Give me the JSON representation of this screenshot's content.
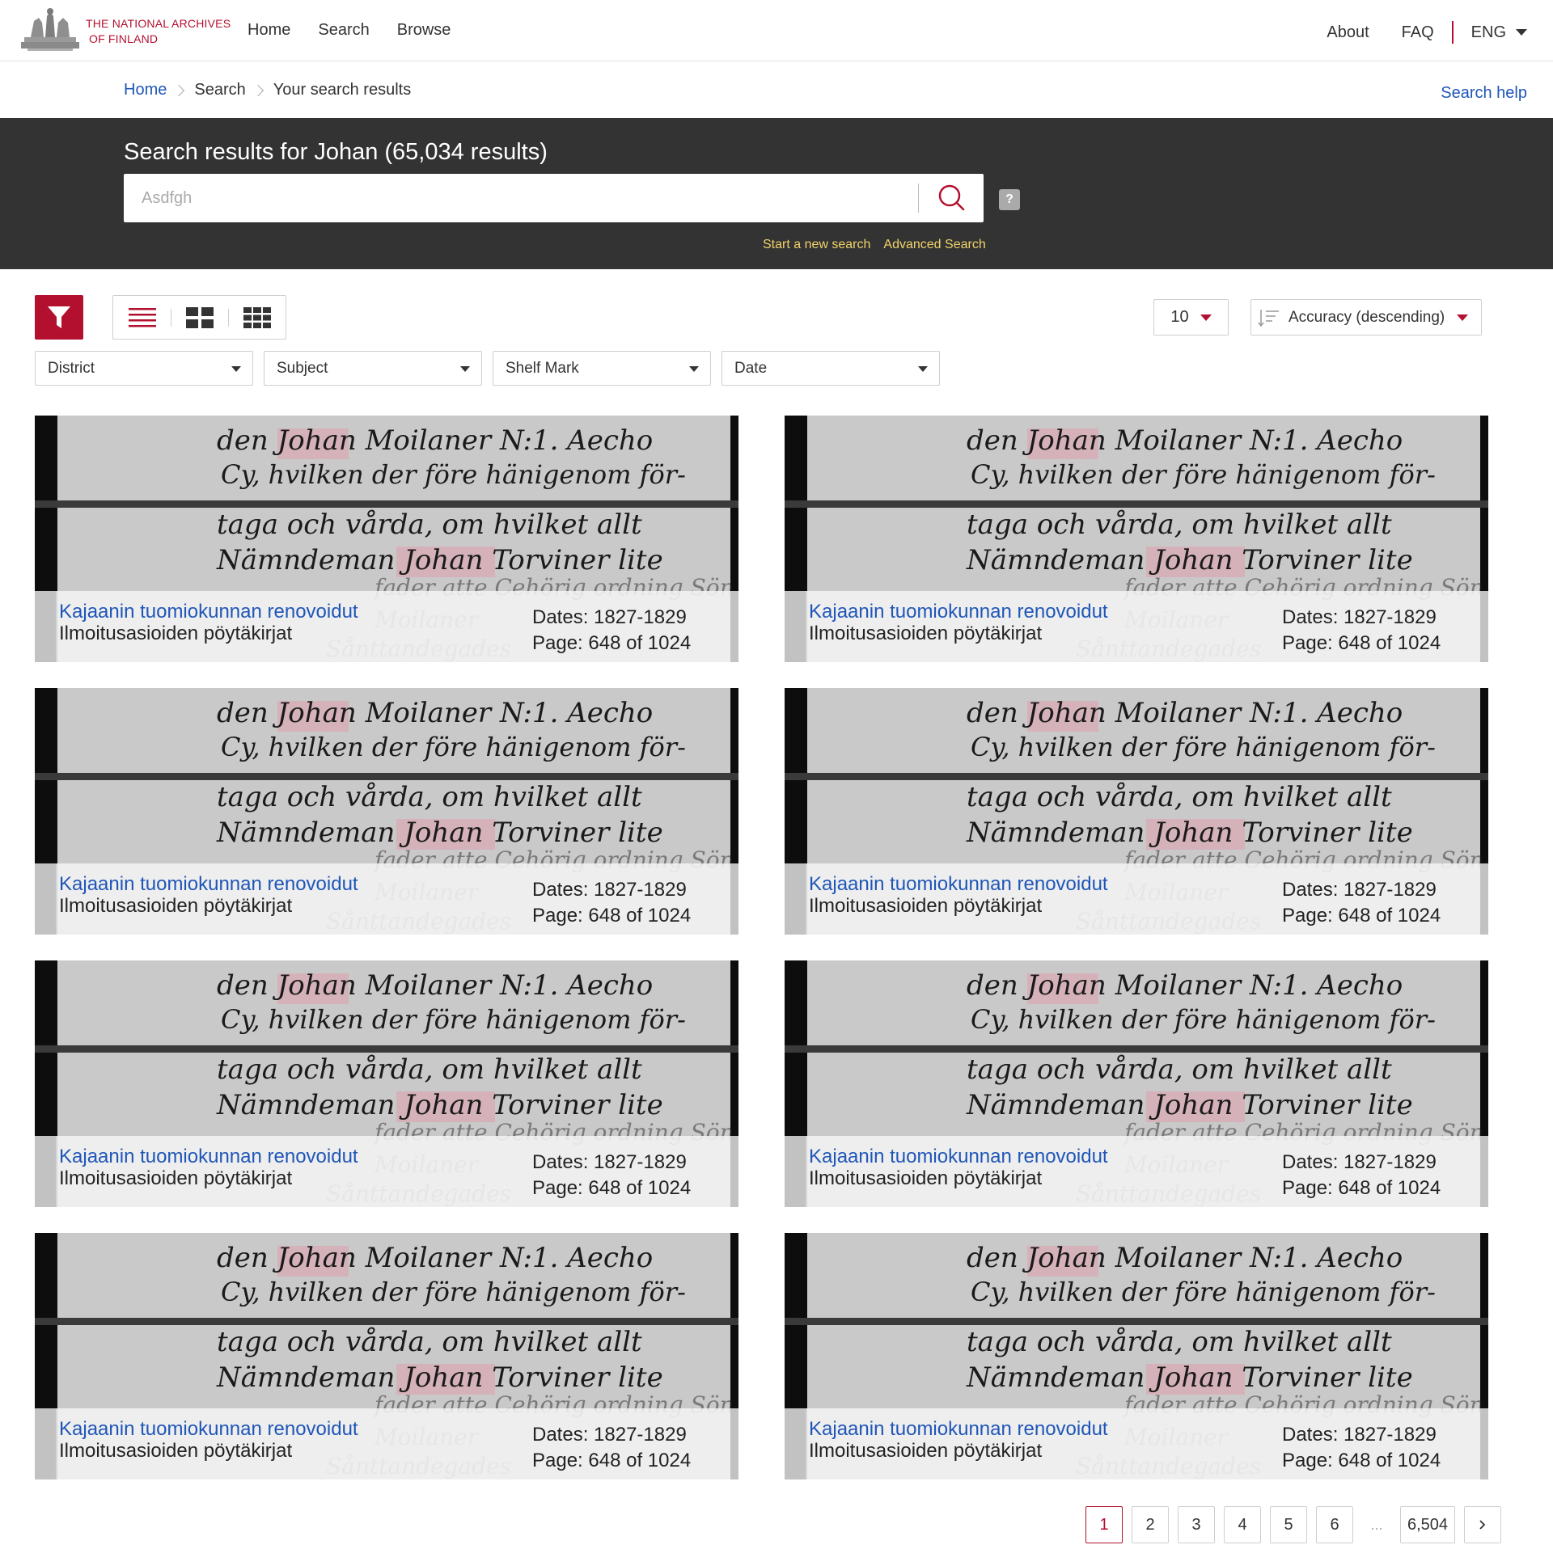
{
  "header": {
    "logo_line1": "THE NATIONAL ARCHIVES",
    "logo_line2": "OF FINLAND",
    "nav_left": [
      "Home",
      "Search",
      "Browse"
    ],
    "nav_right": [
      "About",
      "FAQ"
    ],
    "language": "ENG"
  },
  "breadcrumb": {
    "items": [
      "Home",
      "Search",
      "Your search results"
    ],
    "search_help": "Search help"
  },
  "search": {
    "title": "Search results for Johan (65,034 results)",
    "placeholder": "Asdfgh",
    "help_badge": "?",
    "start_new": "Start a new search",
    "advanced": "Advanced Search"
  },
  "toolbar": {
    "per_page": "10",
    "sort": "Accuracy (descending)"
  },
  "filters": [
    "District",
    "Subject",
    "Shelf Mark",
    "Date"
  ],
  "results": [
    {
      "title": "Kajaanin tuomiokunnan renovoidut",
      "subtitle": "Ilmoitusasioiden pöytäkirjat",
      "dates": "Dates: 1827-1829",
      "page": "Page: 648 of 1024"
    },
    {
      "title": "Kajaanin tuomiokunnan renovoidut",
      "subtitle": "Ilmoitusasioiden pöytäkirjat",
      "dates": "Dates: 1827-1829",
      "page": "Page: 648 of 1024"
    },
    {
      "title": "Kajaanin tuomiokunnan renovoidut",
      "subtitle": "Ilmoitusasioiden pöytäkirjat",
      "dates": "Dates: 1827-1829",
      "page": "Page: 648 of 1024"
    },
    {
      "title": "Kajaanin tuomiokunnan renovoidut",
      "subtitle": "Ilmoitusasioiden pöytäkirjat",
      "dates": "Dates: 1827-1829",
      "page": "Page: 648 of 1024"
    },
    {
      "title": "Kajaanin tuomiokunnan renovoidut",
      "subtitle": "Ilmoitusasioiden pöytäkirjat",
      "dates": "Dates: 1827-1829",
      "page": "Page: 648 of 1024"
    },
    {
      "title": "Kajaanin tuomiokunnan renovoidut",
      "subtitle": "Ilmoitusasioiden pöytäkirjat",
      "dates": "Dates: 1827-1829",
      "page": "Page: 648 of 1024"
    },
    {
      "title": "Kajaanin tuomiokunnan renovoidut",
      "subtitle": "Ilmoitusasioiden pöytäkirjat",
      "dates": "Dates: 1827-1829",
      "page": "Page: 648 of 1024"
    },
    {
      "title": "Kajaanin tuomiokunnan renovoidut",
      "subtitle": "Ilmoitusasioiden pöytäkirjat",
      "dates": "Dates: 1827-1829",
      "page": "Page: 648 of 1024"
    }
  ],
  "scan_text": {
    "line1": "den Johan Moilaner N:1. Aecho",
    "line2": "Cy, hvilken der före hänigenom för-",
    "line3": "taga och vårda, om hvilket allt",
    "line4": "Nämndeman Johan Torviner lite",
    "line5": "fader atte Cehörig ordning Sön",
    "line6": "Moilaner",
    "line7": "Sånttandegades"
  },
  "pagination": {
    "pages": [
      "1",
      "2",
      "3",
      "4",
      "5",
      "6"
    ],
    "ellipsis": "...",
    "last": "6,504",
    "current": "1"
  },
  "colors": {
    "brand_red": "#b3102f",
    "link_blue": "#1f56b8",
    "band_dark": "#333333",
    "band_link_yellow": "#f2d36a"
  },
  "icons": [
    "archives-logo",
    "search-icon",
    "help-icon",
    "filter-icon",
    "list-view-icon",
    "large-grid-view-icon",
    "small-grid-view-icon",
    "sort-icon",
    "chevron-down-icon",
    "chevron-right-icon"
  ]
}
